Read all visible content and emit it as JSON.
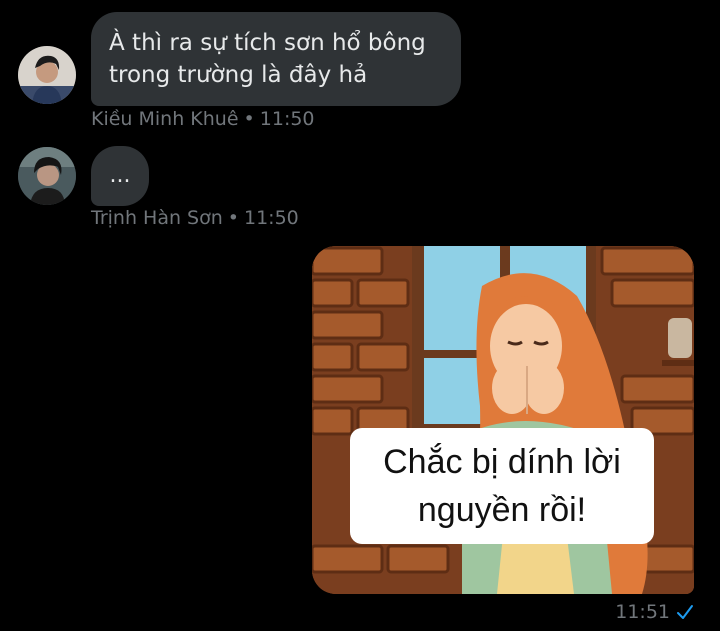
{
  "messages": [
    {
      "sender": "Kiều Minh Khuê",
      "time": "11:50",
      "lines": [
        "À thì ra sự tích sơn hổ bông",
        "trong trường là đây hả"
      ]
    },
    {
      "sender": "Trịnh Hàn Sơn",
      "time": "11:50",
      "text": "..."
    }
  ],
  "meta_separator": "•",
  "sent_image": {
    "caption_lines": [
      "Chắc bị dính lời",
      "nguyền rồi!"
    ],
    "time": "11:51",
    "status_icon": "check-icon"
  },
  "colors": {
    "background": "#000000",
    "bubble": "#2f3336",
    "meta_text": "#71767b",
    "accent": "#1d9bf0"
  }
}
